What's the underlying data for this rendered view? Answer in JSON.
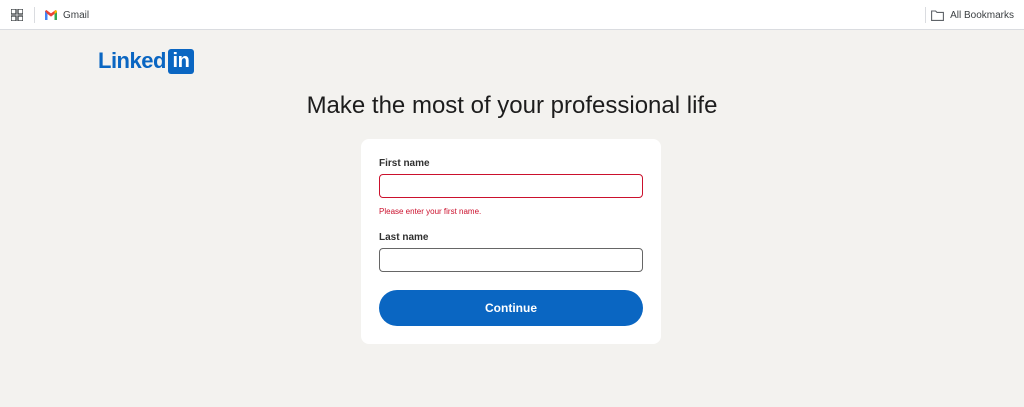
{
  "bookmarks_bar": {
    "gmail_label": "Gmail",
    "all_bookmarks_label": "All Bookmarks"
  },
  "logo": {
    "word": "Linked",
    "box": "in",
    "color": "#0a66c2"
  },
  "headline": "Make the most of your professional life",
  "form": {
    "first_name_label": "First name",
    "first_name_value": "",
    "first_name_error": "Please enter your first name.",
    "last_name_label": "Last name",
    "last_name_value": "",
    "continue_label": "Continue"
  },
  "colors": {
    "accent": "#0a66c2",
    "error": "#cb112d",
    "background": "#f3f2ef"
  }
}
